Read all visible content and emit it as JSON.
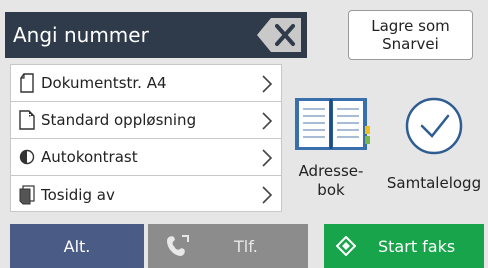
{
  "number_entry": {
    "placeholder": "Angi nummer"
  },
  "shortcut_button": {
    "line1": "Lagre som",
    "line2": "Snarvei"
  },
  "settings": [
    {
      "label": "Dokumentstr. A4",
      "icon": "document-size-icon"
    },
    {
      "label": "Standard oppløsning",
      "icon": "resolution-icon"
    },
    {
      "label": "Autokontrast",
      "icon": "contrast-icon"
    },
    {
      "label": "Tosidig av",
      "icon": "duplex-icon"
    }
  ],
  "address_book": {
    "label": "Adresse-\nbok",
    "icon": "address-book-icon"
  },
  "call_log": {
    "label": "Samtalelogg",
    "icon": "clock-icon"
  },
  "bottom": {
    "alt_label": "Alt.",
    "tel_label": "Tlf.",
    "start_label": "Start faks"
  },
  "colors": {
    "number_bar": "#2f3a4a",
    "alt_button": "#4a5c86",
    "tel_button": "#8c8c8c",
    "start_button": "#17a44a",
    "address_book_accent": "#f0c020",
    "address_book_body": "#3a6fae"
  }
}
